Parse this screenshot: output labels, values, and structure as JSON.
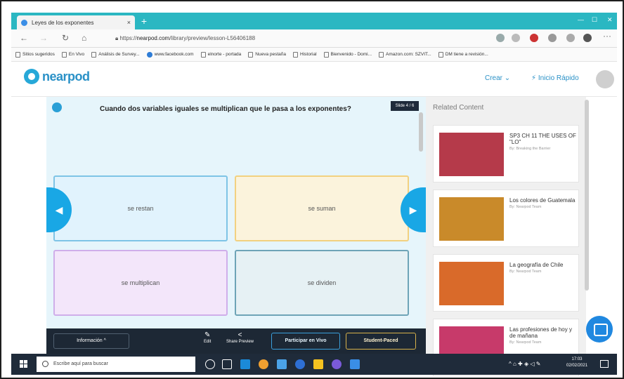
{
  "browser": {
    "tab_title": "Leyes de los exponentes",
    "tab_close": "×",
    "new_tab": "+",
    "url_prefix": "https://",
    "url_host": "nearpod.com",
    "url_path": "/library/preview/lesson-L56406188",
    "bookmarks": [
      {
        "label": "Sitios sugeridos",
        "icon": "page-icon"
      },
      {
        "label": "En Vivo",
        "icon": "page-icon"
      },
      {
        "label": "Análisis de Survey...",
        "icon": "page-icon"
      },
      {
        "label": "www.facebook.com",
        "icon": "globe-icon"
      },
      {
        "label": "elnorte - portada",
        "icon": "page-icon"
      },
      {
        "label": "Nueva pestaña",
        "icon": "page-icon"
      },
      {
        "label": "Historial",
        "icon": "page-icon"
      },
      {
        "label": "Bienvenido - Domi...",
        "icon": "page-icon"
      },
      {
        "label": "Amazon.com: SZVIT...",
        "icon": "page-icon"
      },
      {
        "label": "DM tiene a revisión...",
        "icon": "page-icon"
      }
    ]
  },
  "header": {
    "logo": "nearpod",
    "crear": "Crear ⌄",
    "inicio": "Inicio Rápido"
  },
  "lesson": {
    "question": "Cuando dos variables  iguales se multiplican que le pasa a los exponentes?",
    "slide_badge": "Slide 4 / 6",
    "options": [
      "se restan",
      "se suman",
      "se multiplican",
      "se dividen"
    ]
  },
  "toolbar": {
    "info": "Información  ^",
    "edit": "Edit",
    "share": "Share Preview",
    "vivo": "Participar en Vivo",
    "paced": "Student-Paced"
  },
  "related": {
    "title": "Related Content",
    "items": [
      {
        "title": "SP3 CH 11 THE USES OF \"LO\"",
        "by": "By: Breaking the Barrier",
        "color": "#b53a4a"
      },
      {
        "title": "Los colores de Guatemala",
        "by": "By: Nearpod Team",
        "color": "#c98a2a"
      },
      {
        "title": "La geografía de Chile",
        "by": "By: Nearpod Team",
        "color": "#d96a2a"
      },
      {
        "title": "Las profesiones de hoy y de mañana",
        "by": "By: Nearpod Team",
        "color": "#c73a6a"
      }
    ]
  },
  "taskbar": {
    "search_placeholder": "Escribe aquí para buscar",
    "time": "17:03",
    "date": "02/02/2021"
  },
  "colors": {
    "accent": "#19a7e5",
    "tab_strip": "#2bb7c2",
    "toolbar_bg": "#1d2835"
  }
}
